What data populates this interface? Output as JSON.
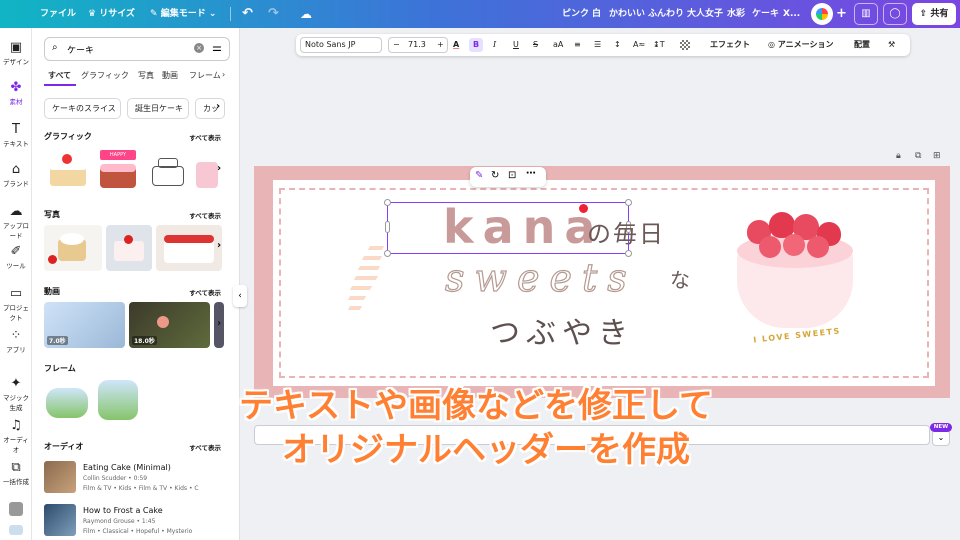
{
  "topbar": {
    "file": "ファイル",
    "resize": "リサイズ",
    "edit_mode": "編集モード",
    "keywords": [
      "ピンク",
      "白",
      "かわいい",
      "ふんわり",
      "大人女子",
      "水彩",
      "ケーキ",
      "X..."
    ],
    "share": "共有"
  },
  "leftrail": {
    "items": [
      "デザイン",
      "素材",
      "テキスト",
      "ブランド",
      "アップロード",
      "ツール",
      "プロジェクト",
      "アプリ",
      "マジック生成",
      "オーディオ",
      "一括作成"
    ]
  },
  "panel": {
    "search_value": "ケーキ",
    "tabs": [
      "すべて",
      "グラフィック",
      "写真",
      "動画",
      "フレーム"
    ],
    "chips": [
      "ケーキのスライス",
      "誕生日ケーキ",
      "カッ"
    ],
    "see_all": "すべて表示",
    "sections": {
      "graphics": "グラフィック",
      "photos": "写真",
      "videos": "動画",
      "frames": "フレーム",
      "audio": "オーディオ"
    },
    "video_durations": [
      "7.0秒",
      "18.0秒"
    ],
    "audio": [
      {
        "title": "Eating Cake (Minimal)",
        "artist": "Collin Scudder • 0:59",
        "tags": "Film & TV • Kids • Film & TV • Kids • C"
      },
      {
        "title": "How to Frost a Cake",
        "artist": "Raymond Grouse • 1:45",
        "tags": "Film • Classical • Hopeful • Mysterio"
      }
    ]
  },
  "toolbar": {
    "font": "Noto Sans JP",
    "minus": "−",
    "size": "71.3",
    "plus": "+",
    "effects": "エフェクト",
    "animation": "アニメーション",
    "position": "配置"
  },
  "design": {
    "kana": "kana",
    "no_mainichi": "の毎日",
    "sweets": "sweets",
    "na": "な",
    "tsubuyaki": "つぶやき",
    "cake_label": "I LOVE SWEETS"
  },
  "badge": "NEW",
  "caption": {
    "line1": "テキストや画像などを修正して",
    "line2": "オリジナルヘッダーを作成"
  },
  "colors": {
    "accent": "#8b3dff",
    "pink_frame": "#e8b4b5",
    "caption": "#ff8033",
    "kana_text": "#c99a9a"
  }
}
